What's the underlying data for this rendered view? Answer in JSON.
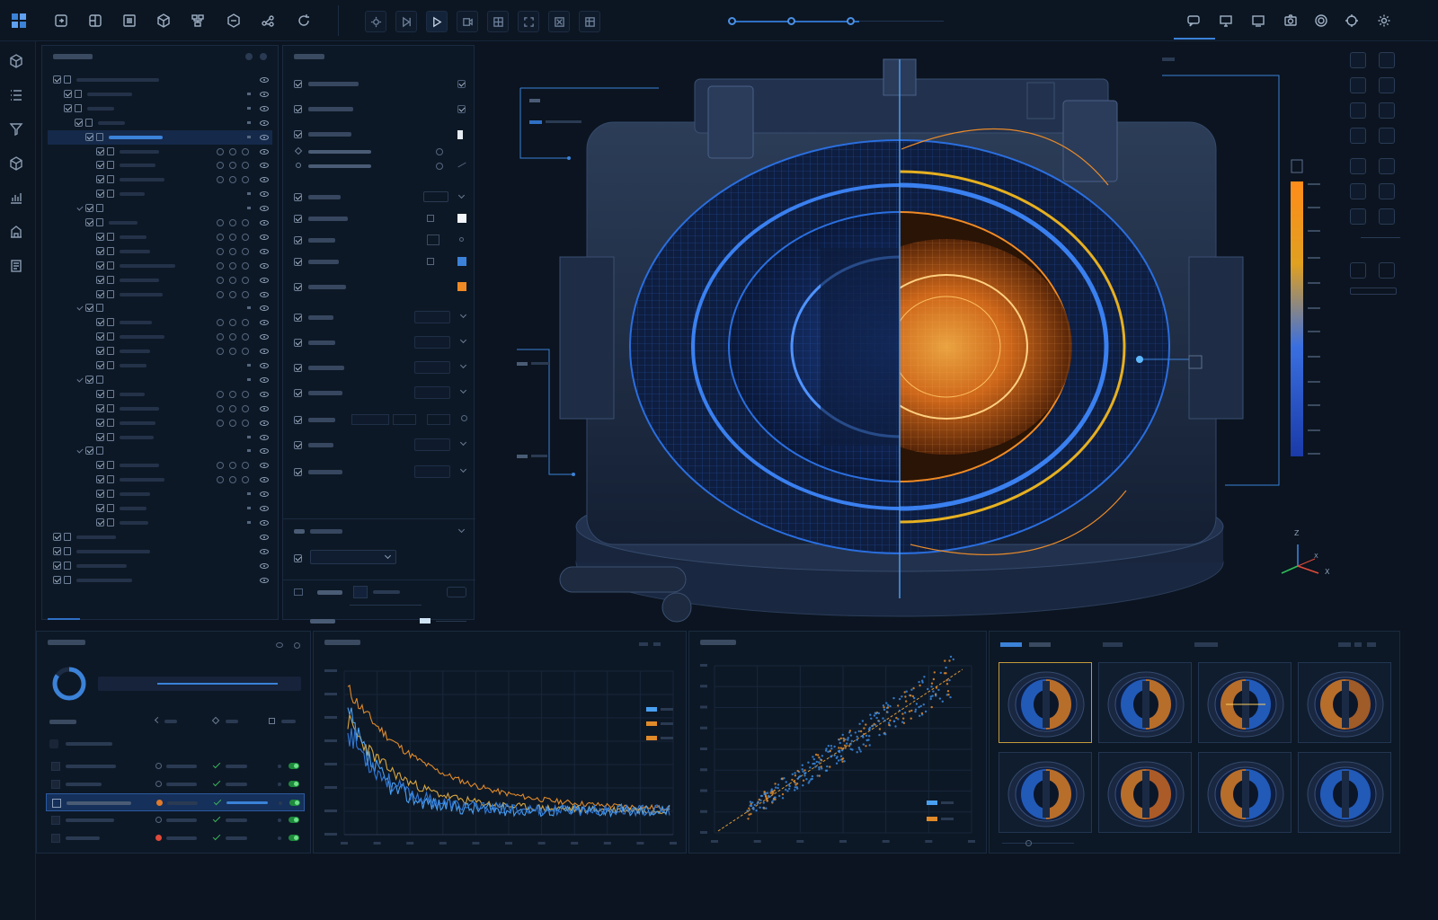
{
  "app": {
    "accent": "#3b82d8",
    "hot_color": "#f08a24",
    "cold_color": "#2a6fe0"
  },
  "toolbar": {
    "left_icons": [
      "logo-icon",
      "import-icon",
      "mesh-icon",
      "list-icon",
      "cube-icon",
      "network-icon",
      "component-icon",
      "share-icon",
      "refresh-icon"
    ],
    "run_buttons": [
      "settings-icon",
      "step-icon",
      "play-icon",
      "record-icon",
      "grid-icon",
      "frame-icon",
      "expand-icon",
      "layers-icon"
    ],
    "right_icons": [
      "chat-icon",
      "monitor-icon",
      "display-icon",
      "camera-icon",
      "settings-gear-icon",
      "target-icon",
      "gear-icon"
    ]
  },
  "rail": {
    "icons": [
      "cube-icon",
      "list-icon",
      "filter-icon",
      "box-icon",
      "chart-icon",
      "building-icon",
      "report-icon"
    ]
  },
  "axes": {
    "z": "Z",
    "x_small": "X",
    "x": "X"
  }
}
